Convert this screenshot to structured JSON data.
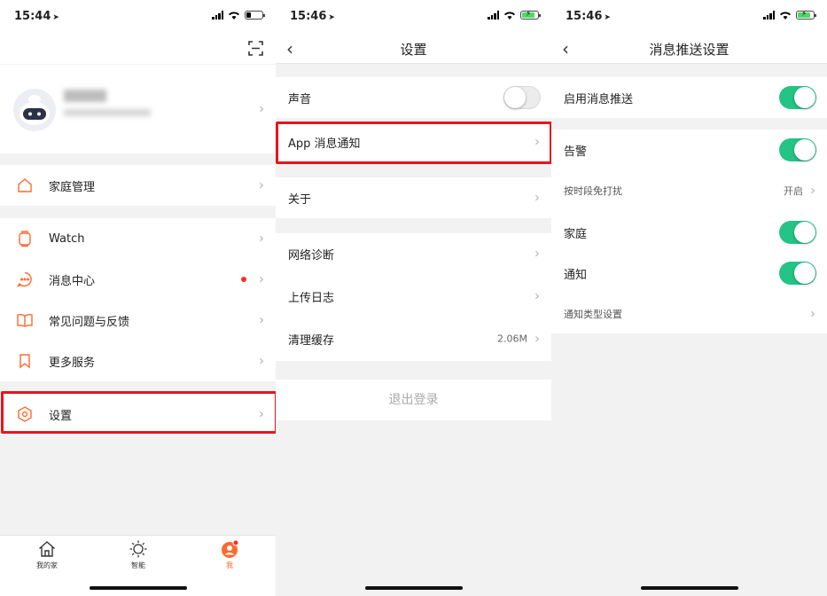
{
  "colors": {
    "accent": "#ff6a2c",
    "toggle_on": "#23c485",
    "highlight": "#e8141b",
    "badge": "#ff2a2a"
  },
  "screen1": {
    "time": "15:44",
    "menu": [
      {
        "label": "家庭管理",
        "icon": "home-icon"
      },
      {
        "label": "Watch",
        "icon": "watch-icon"
      },
      {
        "label": "消息中心",
        "icon": "message-icon"
      },
      {
        "label": "常见问题与反馈",
        "icon": "book-icon"
      },
      {
        "label": "更多服务",
        "icon": "bookmark-icon"
      },
      {
        "label": "设置",
        "icon": "settings-hexagon-icon"
      }
    ],
    "tabs": [
      {
        "label": "我的家",
        "icon": "house-icon"
      },
      {
        "label": "智能",
        "icon": "sun-icon"
      },
      {
        "label": "我",
        "icon": "user-icon"
      }
    ]
  },
  "screen2": {
    "time": "15:46",
    "title": "设置",
    "rows": {
      "sound": "声音",
      "notify": "App 消息通知",
      "about": "关于",
      "network": "网络诊断",
      "upload": "上传日志",
      "cache": "清理缓存",
      "cache_value": "2.06M"
    },
    "logout": "退出登录"
  },
  "screen3": {
    "time": "15:46",
    "title": "消息推送设置",
    "rows": {
      "enable": "启用消息推送",
      "alarm": "告警",
      "dnd": "按时段免打扰",
      "dnd_value": "开启",
      "family": "家庭",
      "notice": "通知",
      "types": "通知类型设置"
    }
  }
}
